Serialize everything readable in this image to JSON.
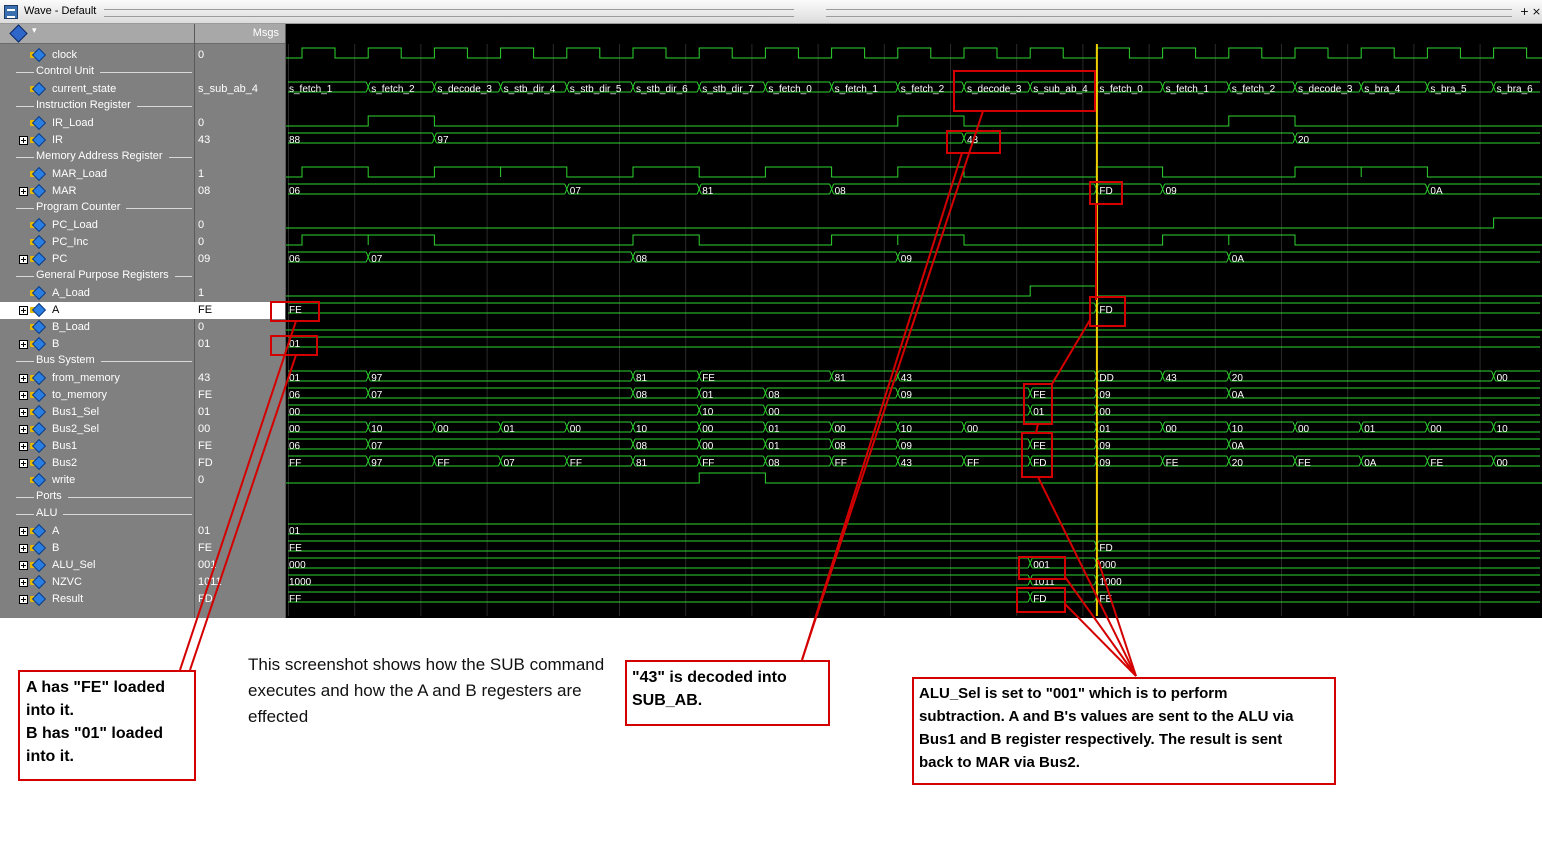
{
  "window": {
    "title": "Wave - Default",
    "buttons": [
      "+",
      "×"
    ]
  },
  "header": {
    "value_column_label": "Msgs"
  },
  "signals": [
    {
      "type": "signal",
      "name": "clock",
      "value": "0",
      "icon": "signal-icon"
    },
    {
      "type": "group",
      "name": "Control Unit"
    },
    {
      "type": "signal",
      "name": "current_state",
      "value": "s_sub_ab_4",
      "icon": "signal-icon"
    },
    {
      "type": "group",
      "name": "Instruction Register"
    },
    {
      "type": "signal",
      "name": "IR_Load",
      "value": "0",
      "icon": "signal-icon"
    },
    {
      "type": "bus",
      "name": "IR",
      "value": "43",
      "icon": "bus-icon"
    },
    {
      "type": "group",
      "name": "Memory Address Register"
    },
    {
      "type": "signal",
      "name": "MAR_Load",
      "value": "1",
      "icon": "signal-icon"
    },
    {
      "type": "bus",
      "name": "MAR",
      "value": "08",
      "icon": "bus-icon"
    },
    {
      "type": "group",
      "name": "Program Counter"
    },
    {
      "type": "signal",
      "name": "PC_Load",
      "value": "0",
      "icon": "signal-icon"
    },
    {
      "type": "signal",
      "name": "PC_Inc",
      "value": "0",
      "icon": "signal-icon"
    },
    {
      "type": "bus",
      "name": "PC",
      "value": "09",
      "icon": "bus-icon"
    },
    {
      "type": "group",
      "name": "General Purpose Registers"
    },
    {
      "type": "signal",
      "name": "A_Load",
      "value": "1",
      "icon": "signal-icon"
    },
    {
      "type": "bus",
      "name": "A",
      "value": "FE",
      "icon": "bus-icon",
      "selected": true
    },
    {
      "type": "signal",
      "name": "B_Load",
      "value": "0",
      "icon": "signal-icon"
    },
    {
      "type": "bus",
      "name": "B",
      "value": "01",
      "icon": "bus-icon"
    },
    {
      "type": "group",
      "name": "Bus System"
    },
    {
      "type": "bus",
      "name": "from_memory",
      "value": "43",
      "icon": "bus-icon"
    },
    {
      "type": "bus",
      "name": "to_memory",
      "value": "FE",
      "icon": "bus-icon"
    },
    {
      "type": "bus",
      "name": "Bus1_Sel",
      "value": "01",
      "icon": "bus-icon"
    },
    {
      "type": "bus",
      "name": "Bus2_Sel",
      "value": "00",
      "icon": "bus-icon"
    },
    {
      "type": "bus",
      "name": "Bus1",
      "value": "FE",
      "icon": "bus-icon"
    },
    {
      "type": "bus",
      "name": "Bus2",
      "value": "FD",
      "icon": "bus-icon"
    },
    {
      "type": "signal",
      "name": "write",
      "value": "0",
      "icon": "signal-icon"
    },
    {
      "type": "group",
      "name": "Ports"
    },
    {
      "type": "group",
      "name": "ALU"
    },
    {
      "type": "bus",
      "name": "A",
      "value": "01",
      "icon": "bus-icon"
    },
    {
      "type": "bus",
      "name": "B",
      "value": "FE",
      "icon": "bus-icon"
    },
    {
      "type": "bus",
      "name": "ALU_Sel",
      "value": "001",
      "icon": "bus-icon"
    },
    {
      "type": "bus",
      "name": "NZVC",
      "value": "1011",
      "icon": "bus-icon"
    },
    {
      "type": "bus",
      "name": "Result",
      "value": "FD",
      "icon": "bus-icon"
    }
  ],
  "waves": {
    "clock": {
      "kind": "clock"
    },
    "current_state": {
      "kind": "bus",
      "segments": [
        [
          "s_fetch_1",
          0
        ],
        [
          "s_fetch_2",
          1
        ],
        [
          "s_decode_3",
          2
        ],
        [
          "s_stb_dir_4",
          3
        ],
        [
          "s_stb_dir_5",
          4
        ],
        [
          "s_stb_dir_6",
          5
        ],
        [
          "s_stb_dir_7",
          6
        ],
        [
          "s_fetch_0",
          7
        ],
        [
          "s_fetch_1",
          8
        ],
        [
          "s_fetch_2",
          9
        ],
        [
          "s_decode_3",
          10
        ],
        [
          "s_sub_ab_4",
          11
        ],
        [
          "s_fetch_0",
          12
        ],
        [
          "s_fetch_1",
          13
        ],
        [
          "s_fetch_2",
          14
        ],
        [
          "s_decode_3",
          15
        ],
        [
          "s_bra_4",
          16
        ],
        [
          "s_bra_5",
          17
        ],
        [
          "s_bra_6",
          18
        ]
      ]
    },
    "IR_Load": {
      "kind": "logic",
      "highs": [
        [
          1,
          2
        ],
        [
          9,
          10
        ],
        [
          14,
          15
        ]
      ]
    },
    "IR": {
      "kind": "bus",
      "segments": [
        [
          "88",
          0
        ],
        [
          "97",
          2
        ],
        [
          "43",
          10
        ],
        [
          "20",
          15
        ]
      ]
    },
    "MAR_Load": {
      "kind": "logic",
      "highs": [
        [
          0,
          1
        ],
        [
          2,
          3
        ],
        [
          3,
          4
        ],
        [
          5,
          6
        ],
        [
          7,
          8
        ],
        [
          9,
          10
        ],
        [
          12,
          13
        ],
        [
          15,
          16
        ],
        [
          16,
          17
        ]
      ]
    },
    "MAR": {
      "kind": "bus",
      "segments": [
        [
          "06",
          0
        ],
        [
          "07",
          4
        ],
        [
          "81",
          6
        ],
        [
          "08",
          8
        ],
        [
          "FD",
          12
        ],
        [
          "09",
          13
        ],
        [
          "0A",
          17
        ]
      ]
    },
    "PC_Load": {
      "kind": "logic",
      "highs": [
        [
          18,
          19
        ]
      ]
    },
    "PC_Inc": {
      "kind": "logic",
      "highs": [
        [
          0,
          1
        ],
        [
          1,
          2
        ],
        [
          5,
          6
        ],
        [
          8,
          9
        ],
        [
          9,
          10
        ],
        [
          13,
          14
        ],
        [
          14,
          15
        ]
      ]
    },
    "PC": {
      "kind": "bus",
      "segments": [
        [
          "06",
          0
        ],
        [
          "07",
          1
        ],
        [
          "08",
          5
        ],
        [
          "09",
          9
        ],
        [
          "0A",
          14
        ]
      ]
    },
    "A_Load": {
      "kind": "logic",
      "highs": [
        [
          11,
          12
        ]
      ]
    },
    "A": {
      "kind": "bus",
      "segments": [
        [
          "FE",
          0
        ],
        [
          "FD",
          12
        ]
      ]
    },
    "B_Load": {
      "kind": "logic",
      "highs": []
    },
    "B": {
      "kind": "bus",
      "segments": [
        [
          "01",
          0
        ]
      ]
    },
    "from_memory": {
      "kind": "bus",
      "segments": [
        [
          "01",
          0
        ],
        [
          "97",
          1
        ],
        [
          "81",
          5
        ],
        [
          "FE",
          6
        ],
        [
          "81",
          8
        ],
        [
          "43",
          9
        ],
        [
          "DD",
          12
        ],
        [
          "43",
          13
        ],
        [
          "20",
          14
        ],
        [
          "00",
          18
        ]
      ]
    },
    "to_memory": {
      "kind": "bus",
      "segments": [
        [
          "06",
          0
        ],
        [
          "07",
          1
        ],
        [
          "08",
          5
        ],
        [
          "01",
          6
        ],
        [
          "08",
          7
        ],
        [
          "09",
          9
        ],
        [
          "FE",
          11
        ],
        [
          "09",
          12
        ],
        [
          "0A",
          14
        ]
      ]
    },
    "Bus1_Sel": {
      "kind": "bus",
      "segments": [
        [
          "00",
          0
        ],
        [
          "10",
          6
        ],
        [
          "00",
          7
        ],
        [
          "01",
          11
        ],
        [
          "00",
          12
        ]
      ]
    },
    "Bus2_Sel": {
      "kind": "bus",
      "segments": [
        [
          "00",
          0
        ],
        [
          "10",
          1
        ],
        [
          "00",
          2
        ],
        [
          "01",
          3
        ],
        [
          "00",
          4
        ],
        [
          "10",
          5
        ],
        [
          "00",
          6
        ],
        [
          "01",
          7
        ],
        [
          "00",
          8
        ],
        [
          "10",
          9
        ],
        [
          "00",
          10
        ],
        [
          "01",
          12
        ],
        [
          "00",
          13
        ],
        [
          "10",
          14
        ],
        [
          "00",
          15
        ],
        [
          "01",
          16
        ],
        [
          "00",
          17
        ],
        [
          "10",
          18
        ]
      ]
    },
    "Bus1": {
      "kind": "bus",
      "segments": [
        [
          "06",
          0
        ],
        [
          "07",
          1
        ],
        [
          "08",
          5
        ],
        [
          "00",
          6
        ],
        [
          "01",
          7
        ],
        [
          "08",
          8
        ],
        [
          "09",
          9
        ],
        [
          "FE",
          11
        ],
        [
          "09",
          12
        ],
        [
          "0A",
          14
        ]
      ]
    },
    "Bus2": {
      "kind": "bus",
      "segments": [
        [
          "FF",
          0
        ],
        [
          "97",
          1
        ],
        [
          "FF",
          2
        ],
        [
          "07",
          3
        ],
        [
          "FF",
          4
        ],
        [
          "81",
          5
        ],
        [
          "FF",
          6
        ],
        [
          "08",
          7
        ],
        [
          "FF",
          8
        ],
        [
          "43",
          9
        ],
        [
          "FF",
          10
        ],
        [
          "FD",
          11
        ],
        [
          "09",
          12
        ],
        [
          "FE",
          13
        ],
        [
          "20",
          14
        ],
        [
          "FE",
          15
        ],
        [
          "0A",
          16
        ],
        [
          "FE",
          17
        ],
        [
          "00",
          18
        ]
      ]
    },
    "write": {
      "kind": "logic",
      "highs": [
        [
          6,
          7
        ]
      ]
    },
    "ALU_A": {
      "kind": "bus",
      "segments": [
        [
          "01",
          0
        ]
      ]
    },
    "ALU_B": {
      "kind": "bus",
      "segments": [
        [
          "FE",
          0
        ],
        [
          "FD",
          12
        ]
      ]
    },
    "ALU_Sel": {
      "kind": "bus",
      "segments": [
        [
          "000",
          0
        ],
        [
          "001",
          11
        ],
        [
          "000",
          12
        ]
      ]
    },
    "NZVC": {
      "kind": "bus",
      "segments": [
        [
          "1000",
          0
        ],
        [
          "1011",
          11
        ],
        [
          "1000",
          12
        ]
      ]
    },
    "Result": {
      "kind": "bus",
      "segments": [
        [
          "FF",
          0
        ],
        [
          "FD",
          11
        ],
        [
          "FE",
          12
        ]
      ]
    }
  },
  "annotations": {
    "ab_loaded": [
      "A has \"FE\" loaded",
      "into it.",
      "B has \"01\" loaded",
      "into it."
    ],
    "caption": "This screenshot shows how the SUB command executes and how the A and B regesters are effected",
    "decoded": [
      "\"43\" is decoded into",
      "SUB_AB."
    ],
    "alu_sel": [
      "ALU_Sel  is set to \"001\" which is to perform",
      "subtraction. A and B's values are sent to the ALU via",
      "Bus1 and B register respectively. The result is sent",
      "back to MAR via Bus2."
    ]
  },
  "colors": {
    "wave_green": "#2ed42e",
    "cursor_yellow": "#f0d000",
    "highlight_red": "#d40000",
    "panel_gray": "#808080"
  }
}
